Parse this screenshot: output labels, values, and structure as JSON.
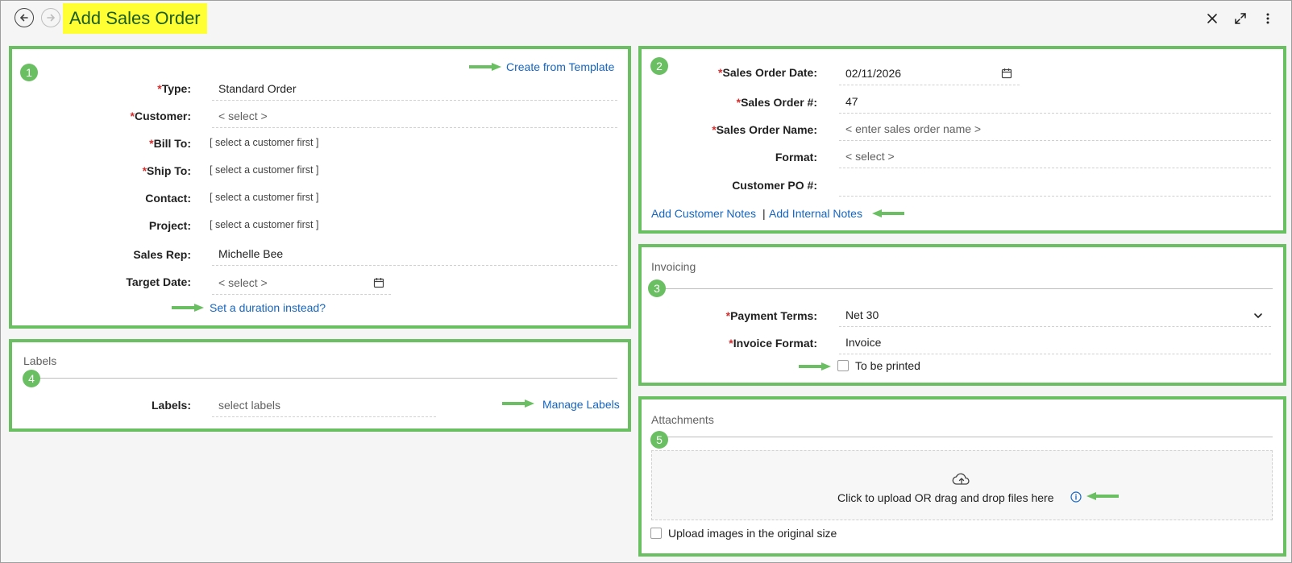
{
  "header": {
    "title": "Add Sales Order"
  },
  "section1": {
    "badge": "1",
    "create_template": "Create from Template",
    "type_label": "Type:",
    "type_value": "Standard Order",
    "customer_label": "Customer:",
    "customer_value": "< select >",
    "billto_label": "Bill To:",
    "billto_value": "[ select a customer first ]",
    "shipto_label": "Ship To:",
    "shipto_value": "[ select a customer first ]",
    "contact_label": "Contact:",
    "contact_value": "[ select a customer first ]",
    "project_label": "Project:",
    "project_value": "[ select a customer first ]",
    "salesrep_label": "Sales Rep:",
    "salesrep_value": "Michelle Bee",
    "targetdate_label": "Target Date:",
    "targetdate_value": "< select >",
    "duration_link": "Set a duration instead?"
  },
  "section2": {
    "badge": "2",
    "date_label": "Sales Order Date:",
    "date_value": "02/11/2026",
    "number_label": "Sales Order #:",
    "number_value": "47",
    "name_label": "Sales Order Name:",
    "name_placeholder": "< enter sales order name >",
    "format_label": "Format:",
    "format_value": "< select >",
    "po_label": "Customer PO #:",
    "po_value": "",
    "customer_notes": "Add Customer Notes",
    "separator": "|",
    "internal_notes": "Add Internal Notes"
  },
  "section3": {
    "badge": "3",
    "title": "Invoicing",
    "terms_label": "Payment Terms:",
    "terms_value": "Net 30",
    "format_label": "Invoice Format:",
    "format_value": "Invoice",
    "printed_label": "To be printed"
  },
  "section4": {
    "badge": "4",
    "title": "Labels",
    "labels_label": "Labels:",
    "labels_placeholder": "select labels",
    "manage": "Manage Labels"
  },
  "section5": {
    "badge": "5",
    "title": "Attachments",
    "upload_text": "Click to upload OR drag and drop files here",
    "original_size": "Upload images in the original size"
  },
  "colors": {
    "accent_green": "#6bbf63",
    "link_blue": "#1565c0",
    "title_bg": "#ffff33",
    "title_fg": "#1b5e20",
    "required": "#d32f2f"
  }
}
